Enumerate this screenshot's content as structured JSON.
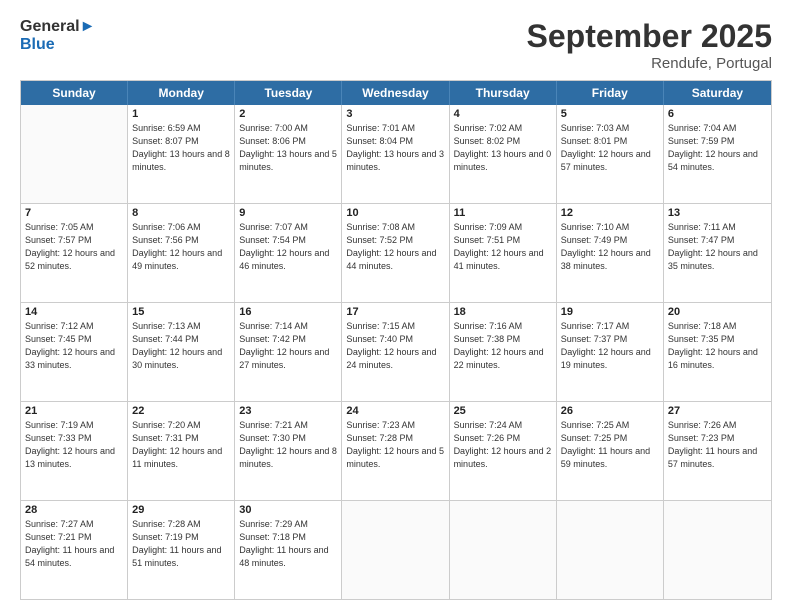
{
  "header": {
    "logo_line1": "General",
    "logo_line2": "Blue",
    "month": "September 2025",
    "location": "Rendufe, Portugal"
  },
  "weekdays": [
    "Sunday",
    "Monday",
    "Tuesday",
    "Wednesday",
    "Thursday",
    "Friday",
    "Saturday"
  ],
  "weeks": [
    [
      {
        "day": "",
        "sunrise": "",
        "sunset": "",
        "daylight": ""
      },
      {
        "day": "1",
        "sunrise": "Sunrise: 6:59 AM",
        "sunset": "Sunset: 8:07 PM",
        "daylight": "Daylight: 13 hours and 8 minutes."
      },
      {
        "day": "2",
        "sunrise": "Sunrise: 7:00 AM",
        "sunset": "Sunset: 8:06 PM",
        "daylight": "Daylight: 13 hours and 5 minutes."
      },
      {
        "day": "3",
        "sunrise": "Sunrise: 7:01 AM",
        "sunset": "Sunset: 8:04 PM",
        "daylight": "Daylight: 13 hours and 3 minutes."
      },
      {
        "day": "4",
        "sunrise": "Sunrise: 7:02 AM",
        "sunset": "Sunset: 8:02 PM",
        "daylight": "Daylight: 13 hours and 0 minutes."
      },
      {
        "day": "5",
        "sunrise": "Sunrise: 7:03 AM",
        "sunset": "Sunset: 8:01 PM",
        "daylight": "Daylight: 12 hours and 57 minutes."
      },
      {
        "day": "6",
        "sunrise": "Sunrise: 7:04 AM",
        "sunset": "Sunset: 7:59 PM",
        "daylight": "Daylight: 12 hours and 54 minutes."
      }
    ],
    [
      {
        "day": "7",
        "sunrise": "Sunrise: 7:05 AM",
        "sunset": "Sunset: 7:57 PM",
        "daylight": "Daylight: 12 hours and 52 minutes."
      },
      {
        "day": "8",
        "sunrise": "Sunrise: 7:06 AM",
        "sunset": "Sunset: 7:56 PM",
        "daylight": "Daylight: 12 hours and 49 minutes."
      },
      {
        "day": "9",
        "sunrise": "Sunrise: 7:07 AM",
        "sunset": "Sunset: 7:54 PM",
        "daylight": "Daylight: 12 hours and 46 minutes."
      },
      {
        "day": "10",
        "sunrise": "Sunrise: 7:08 AM",
        "sunset": "Sunset: 7:52 PM",
        "daylight": "Daylight: 12 hours and 44 minutes."
      },
      {
        "day": "11",
        "sunrise": "Sunrise: 7:09 AM",
        "sunset": "Sunset: 7:51 PM",
        "daylight": "Daylight: 12 hours and 41 minutes."
      },
      {
        "day": "12",
        "sunrise": "Sunrise: 7:10 AM",
        "sunset": "Sunset: 7:49 PM",
        "daylight": "Daylight: 12 hours and 38 minutes."
      },
      {
        "day": "13",
        "sunrise": "Sunrise: 7:11 AM",
        "sunset": "Sunset: 7:47 PM",
        "daylight": "Daylight: 12 hours and 35 minutes."
      }
    ],
    [
      {
        "day": "14",
        "sunrise": "Sunrise: 7:12 AM",
        "sunset": "Sunset: 7:45 PM",
        "daylight": "Daylight: 12 hours and 33 minutes."
      },
      {
        "day": "15",
        "sunrise": "Sunrise: 7:13 AM",
        "sunset": "Sunset: 7:44 PM",
        "daylight": "Daylight: 12 hours and 30 minutes."
      },
      {
        "day": "16",
        "sunrise": "Sunrise: 7:14 AM",
        "sunset": "Sunset: 7:42 PM",
        "daylight": "Daylight: 12 hours and 27 minutes."
      },
      {
        "day": "17",
        "sunrise": "Sunrise: 7:15 AM",
        "sunset": "Sunset: 7:40 PM",
        "daylight": "Daylight: 12 hours and 24 minutes."
      },
      {
        "day": "18",
        "sunrise": "Sunrise: 7:16 AM",
        "sunset": "Sunset: 7:38 PM",
        "daylight": "Daylight: 12 hours and 22 minutes."
      },
      {
        "day": "19",
        "sunrise": "Sunrise: 7:17 AM",
        "sunset": "Sunset: 7:37 PM",
        "daylight": "Daylight: 12 hours and 19 minutes."
      },
      {
        "day": "20",
        "sunrise": "Sunrise: 7:18 AM",
        "sunset": "Sunset: 7:35 PM",
        "daylight": "Daylight: 12 hours and 16 minutes."
      }
    ],
    [
      {
        "day": "21",
        "sunrise": "Sunrise: 7:19 AM",
        "sunset": "Sunset: 7:33 PM",
        "daylight": "Daylight: 12 hours and 13 minutes."
      },
      {
        "day": "22",
        "sunrise": "Sunrise: 7:20 AM",
        "sunset": "Sunset: 7:31 PM",
        "daylight": "Daylight: 12 hours and 11 minutes."
      },
      {
        "day": "23",
        "sunrise": "Sunrise: 7:21 AM",
        "sunset": "Sunset: 7:30 PM",
        "daylight": "Daylight: 12 hours and 8 minutes."
      },
      {
        "day": "24",
        "sunrise": "Sunrise: 7:23 AM",
        "sunset": "Sunset: 7:28 PM",
        "daylight": "Daylight: 12 hours and 5 minutes."
      },
      {
        "day": "25",
        "sunrise": "Sunrise: 7:24 AM",
        "sunset": "Sunset: 7:26 PM",
        "daylight": "Daylight: 12 hours and 2 minutes."
      },
      {
        "day": "26",
        "sunrise": "Sunrise: 7:25 AM",
        "sunset": "Sunset: 7:25 PM",
        "daylight": "Daylight: 11 hours and 59 minutes."
      },
      {
        "day": "27",
        "sunrise": "Sunrise: 7:26 AM",
        "sunset": "Sunset: 7:23 PM",
        "daylight": "Daylight: 11 hours and 57 minutes."
      }
    ],
    [
      {
        "day": "28",
        "sunrise": "Sunrise: 7:27 AM",
        "sunset": "Sunset: 7:21 PM",
        "daylight": "Daylight: 11 hours and 54 minutes."
      },
      {
        "day": "29",
        "sunrise": "Sunrise: 7:28 AM",
        "sunset": "Sunset: 7:19 PM",
        "daylight": "Daylight: 11 hours and 51 minutes."
      },
      {
        "day": "30",
        "sunrise": "Sunrise: 7:29 AM",
        "sunset": "Sunset: 7:18 PM",
        "daylight": "Daylight: 11 hours and 48 minutes."
      },
      {
        "day": "",
        "sunrise": "",
        "sunset": "",
        "daylight": ""
      },
      {
        "day": "",
        "sunrise": "",
        "sunset": "",
        "daylight": ""
      },
      {
        "day": "",
        "sunrise": "",
        "sunset": "",
        "daylight": ""
      },
      {
        "day": "",
        "sunrise": "",
        "sunset": "",
        "daylight": ""
      }
    ]
  ]
}
